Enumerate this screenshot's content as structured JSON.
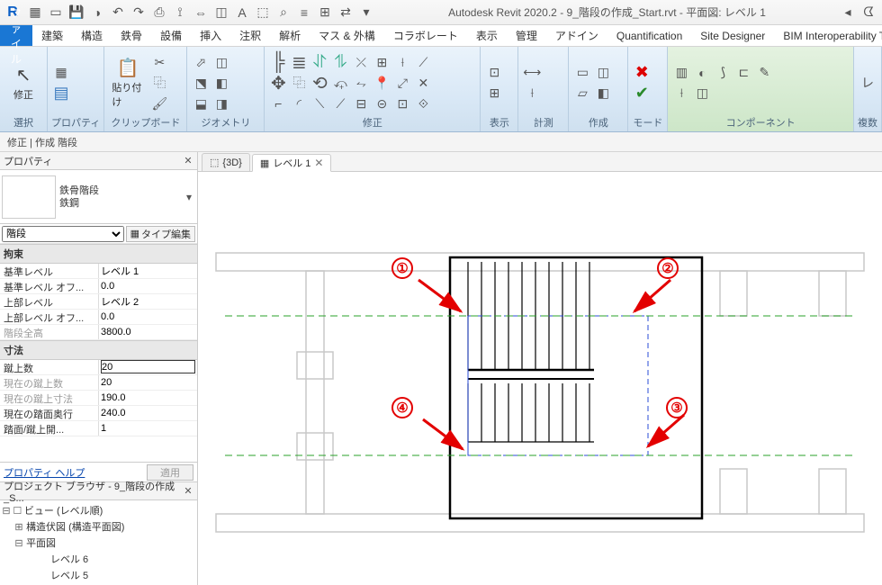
{
  "title_bar": {
    "app_initial": "R",
    "doc_title": "Autodesk Revit 2020.2 - 9_階段の作成_Start.rvt - 平面図: レベル 1"
  },
  "menu": {
    "file": "ファイル",
    "tabs": [
      "建築",
      "構造",
      "鉄骨",
      "設備",
      "挿入",
      "注釈",
      "解析",
      "マス & 外構",
      "コラボレート",
      "表示",
      "管理",
      "アドイン",
      "Quantification",
      "Site Designer",
      "BIM Interoperability Tool"
    ]
  },
  "ribbon": {
    "groups": {
      "select": "選択",
      "properties": "プロパティ",
      "clipboard": "クリップボード",
      "geometry": "ジオメトリ",
      "modify": "修正",
      "view": "表示",
      "measure": "計測",
      "create": "作成",
      "mode": "モード",
      "component": "コンポーネント",
      "multi": "複数"
    },
    "buttons": {
      "modify": "修正",
      "paste": "貼り付け"
    }
  },
  "sub_status": "修正 | 作成 階段",
  "properties": {
    "title": "プロパティ",
    "type_family": "鉄骨階段",
    "type_name": "鉄鋼",
    "category": "階段",
    "type_edit": "タイプ編集",
    "groups": {
      "constraints": "拘束",
      "dimensions": "寸法"
    },
    "rows": {
      "base_level": {
        "n": "基準レベル",
        "v": "レベル 1"
      },
      "base_off": {
        "n": "基準レベル オフ...",
        "v": "0.0"
      },
      "top_level": {
        "n": "上部レベル",
        "v": "レベル 2"
      },
      "top_off": {
        "n": "上部レベル オフ...",
        "v": "0.0"
      },
      "stair_h": {
        "n": "階段全高",
        "v": "3800.0"
      },
      "riser_ct": {
        "n": "蹴上数",
        "v": "20"
      },
      "cur_riser": {
        "n": "現在の蹴上数",
        "v": "20"
      },
      "cur_riser_h": {
        "n": "現在の蹴上寸法",
        "v": "190.0"
      },
      "tread_d": {
        "n": "現在の踏面奥行",
        "v": "240.0"
      },
      "tread_rise": {
        "n": "踏面/蹴上開...",
        "v": "1"
      }
    },
    "help": "プロパティ ヘルプ",
    "apply": "適用"
  },
  "browser": {
    "title": "プロジェクト ブラウザ - 9_階段の作成_S...",
    "root": "ビュー (レベル順)",
    "n1": "構造伏図 (構造平面図)",
    "n2": "平面図",
    "n2a": "レベル 6",
    "n2b": "レベル 5"
  },
  "view_tabs": {
    "t1": "{3D}",
    "t2": "レベル 1"
  },
  "annotations": {
    "a1": "①",
    "a2": "②",
    "a3": "③",
    "a4": "④"
  }
}
